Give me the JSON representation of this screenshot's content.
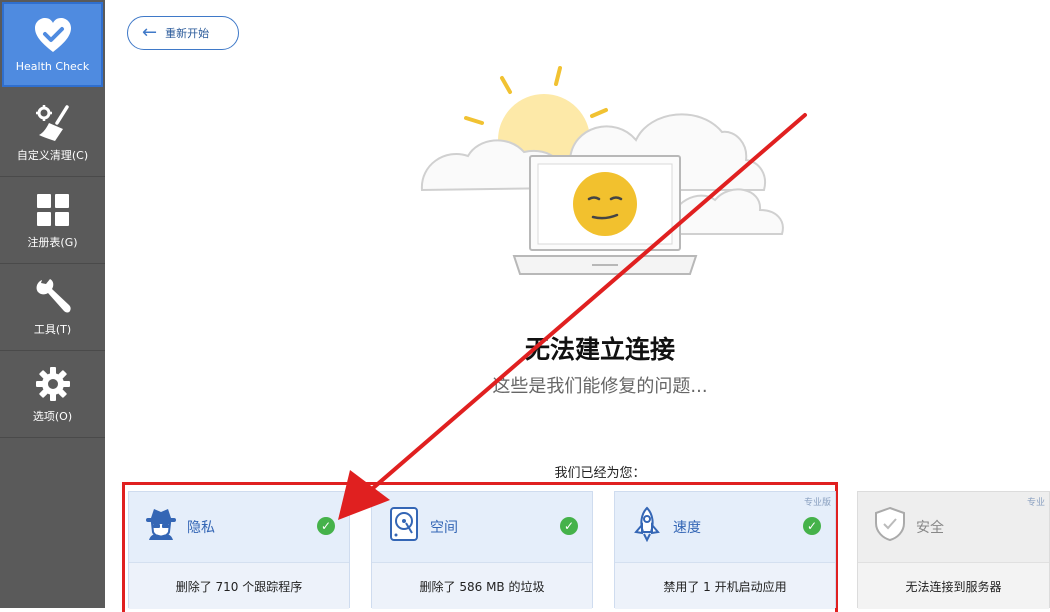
{
  "sidebar": {
    "items": [
      {
        "label": "Health Check",
        "icon": "heart-check-icon",
        "active": true
      },
      {
        "label": "自定义清理(C)",
        "icon": "broom-gear-icon",
        "active": false
      },
      {
        "label": "注册表(G)",
        "icon": "grid-icon",
        "active": false
      },
      {
        "label": "工具(T)",
        "icon": "wrench-icon",
        "active": false
      },
      {
        "label": "选项(O)",
        "icon": "gear-icon",
        "active": false
      }
    ]
  },
  "back_button": {
    "label": "重新开始"
  },
  "status": {
    "title": "无法建立连接",
    "subtitle": "这些是我们能修复的问题..."
  },
  "done_caption": "我们已经为您：",
  "cards": [
    {
      "title": "隐私",
      "result": "删除了 710 个跟踪程序",
      "icon": "spy-privacy-icon",
      "checked": true
    },
    {
      "title": "空间",
      "result": "删除了 586 MB 的垃圾",
      "icon": "disk-space-icon",
      "checked": true
    },
    {
      "title": "速度",
      "result": "禁用了 1 开机启动应用",
      "icon": "rocket-icon",
      "checked": true,
      "badge": "专业版"
    },
    {
      "title": "安全",
      "result": "无法连接到服务器",
      "icon": "shield-icon",
      "checked": false,
      "badge": "专业"
    }
  ],
  "colors": {
    "sidebar": "#5a5a5a",
    "active": "#4f8be0",
    "accent": "#3f79c8",
    "success": "#45b24a",
    "annotation": "#e02020"
  }
}
